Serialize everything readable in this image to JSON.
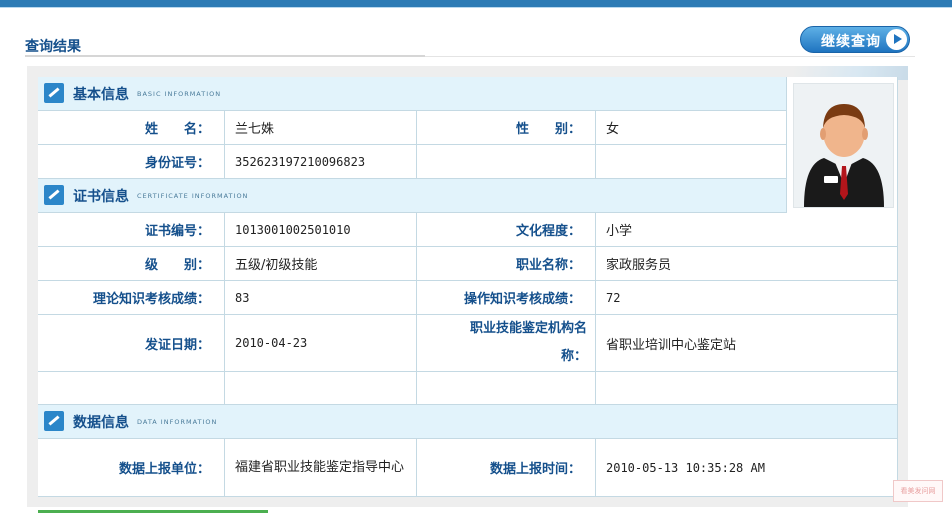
{
  "page": {
    "title": "查询结果",
    "continue_button": "继续查询",
    "watermark_text": "看美发问网"
  },
  "sections": {
    "basic": {
      "title": "基本信息",
      "subtitle": "BASIC INFORMATION"
    },
    "certificate": {
      "title": "证书信息",
      "subtitle": "CERTIFICATE INFORMATION"
    },
    "data": {
      "title": "数据信息",
      "subtitle": "DATA INFORMATION"
    }
  },
  "basic": {
    "name_label": "姓　　名：",
    "name_value": "兰七姝",
    "gender_label": "性　　别：",
    "gender_value": "女",
    "id_label": "身份证号：",
    "id_value": "352623197210096823"
  },
  "certificate": {
    "cert_no_label": "证书编号：",
    "cert_no_value": "1013001002501010",
    "education_label": "文化程度：",
    "education_value": "小学",
    "level_label": "级　　别：",
    "level_value": "五级/初级技能",
    "occupation_label": "职业名称：",
    "occupation_value": "家政服务员",
    "theory_label": "理论知识考核成绩：",
    "theory_value": "83",
    "practice_label": "操作知识考核成绩：",
    "practice_value": "72",
    "issue_date_label": "发证日期：",
    "issue_date_value": "2010-04-23",
    "agency_label": "职业技能鉴定机构名称：",
    "agency_value": "省职业培训中心鉴定站"
  },
  "data_info": {
    "unit_label": "数据上报单位：",
    "unit_value": "福建省职业技能鉴定指导中心",
    "time_label": "数据上报时间：",
    "time_value": "2010-05-13 10:35:28 AM"
  },
  "icons": {
    "section_icon": "pen-icon",
    "photo": "person-avatar-icon",
    "continue": "play-arrow-icon"
  },
  "colors": {
    "accent": "#15508c",
    "section_bg": "#e2f3fb",
    "topbar": "#2d7bb5"
  }
}
